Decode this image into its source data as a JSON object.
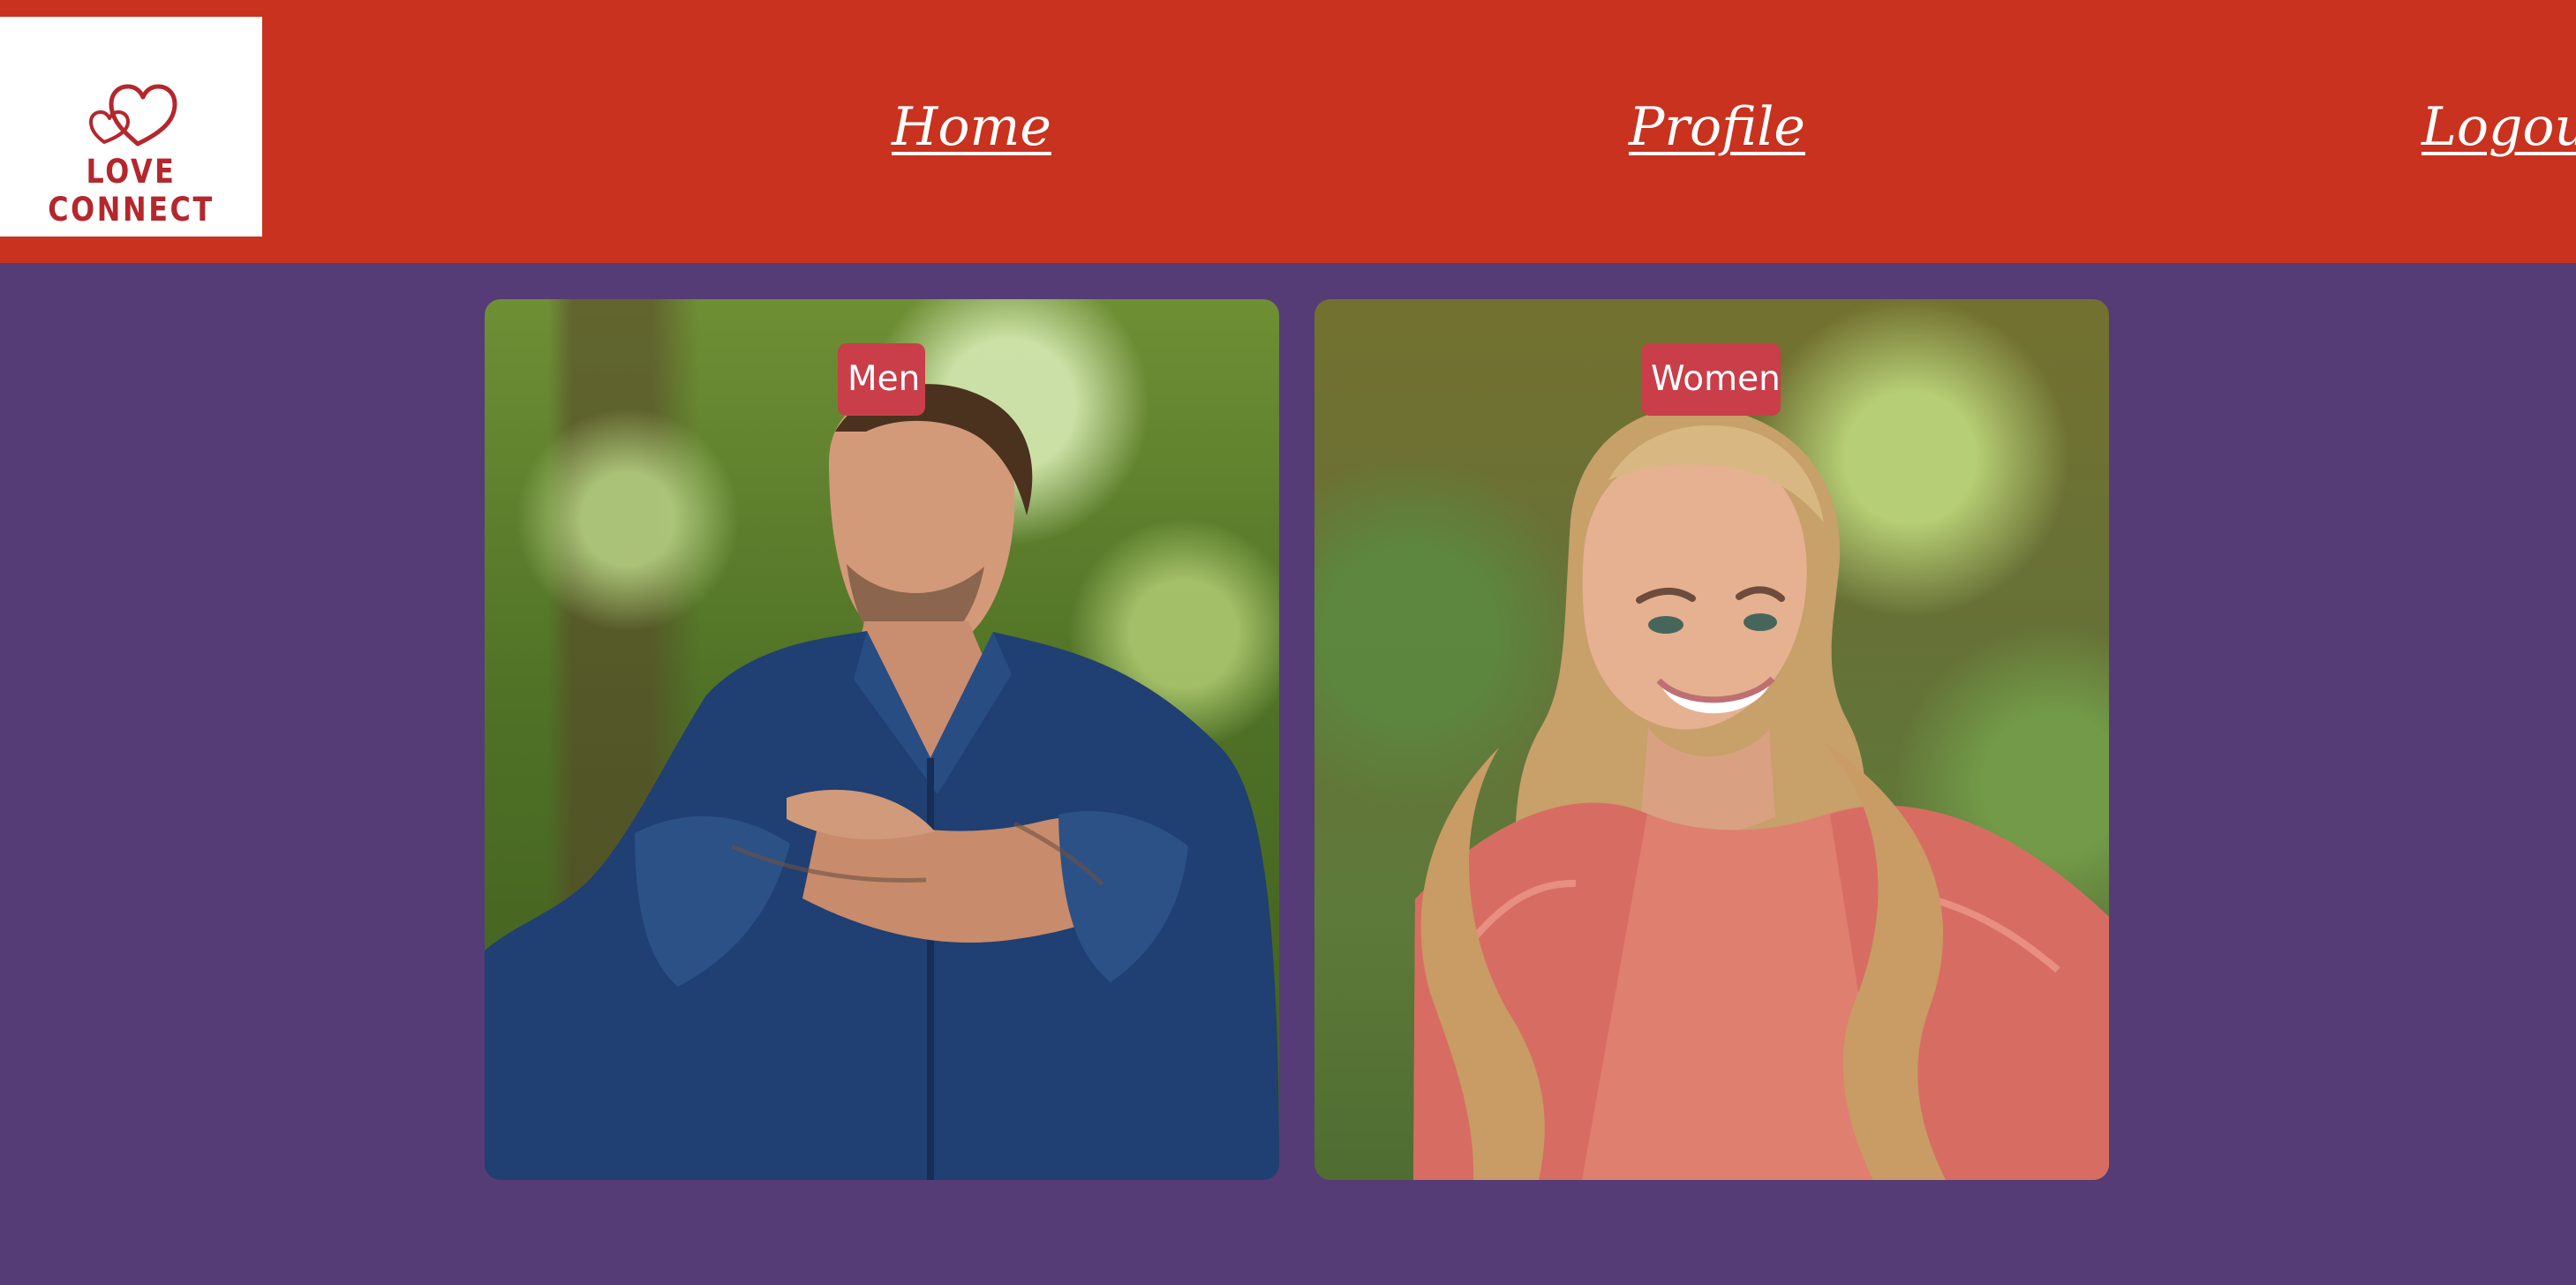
{
  "brand": {
    "name": "LOVE CONNECT",
    "logo_icon": "hearts-icon",
    "color": "#b3272d"
  },
  "nav": {
    "items": [
      {
        "label": "Home"
      },
      {
        "label": "Profile"
      },
      {
        "label": "Logout"
      }
    ]
  },
  "categories": [
    {
      "label": "Men"
    },
    {
      "label": "Women"
    }
  ],
  "colors": {
    "header": "#c8321e",
    "background": "#553c76",
    "badge": "#c93e49"
  }
}
